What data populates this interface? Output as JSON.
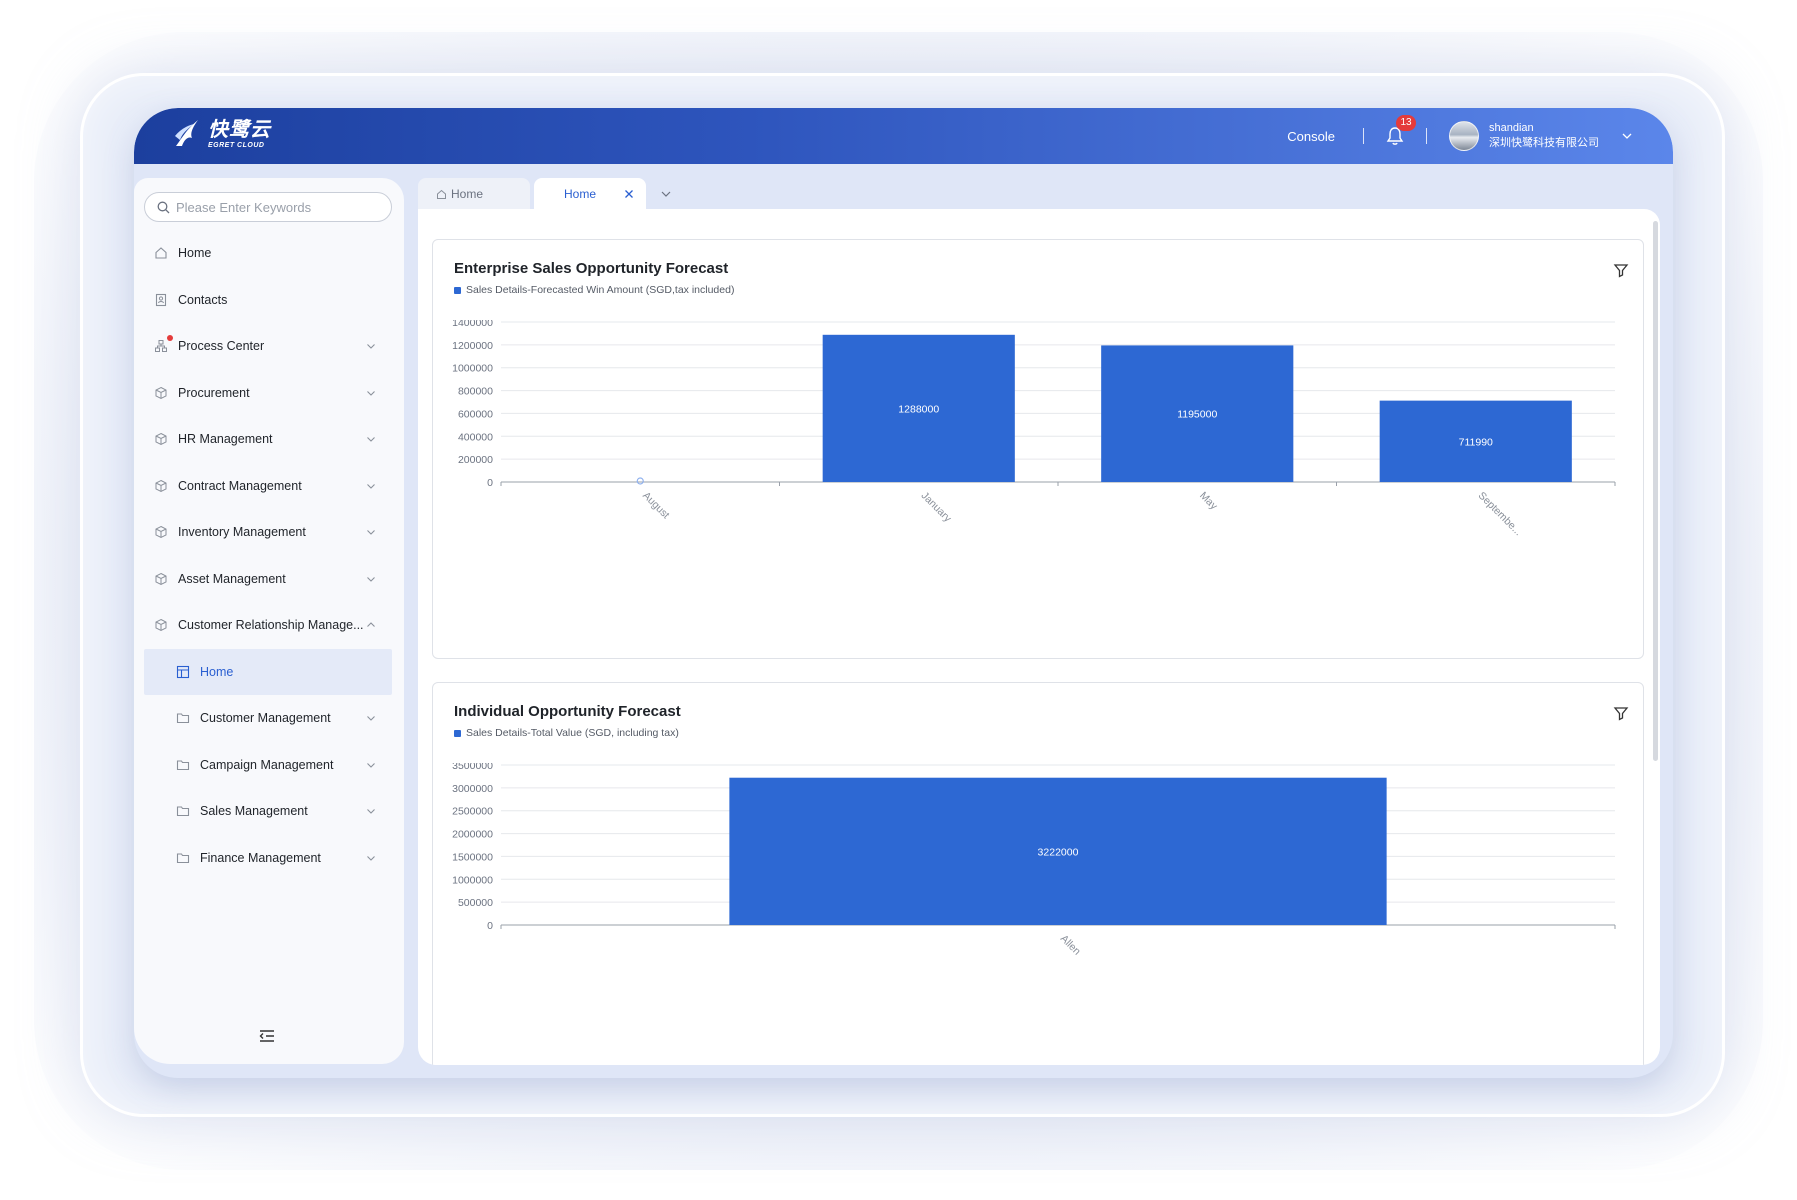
{
  "header": {
    "logo_cn": "快鹭云",
    "logo_en": "EGRET CLOUD",
    "console_label": "Console",
    "notification_count": "13",
    "user_name": "shandian",
    "user_org": "深圳快鹭科技有限公司"
  },
  "sidebar": {
    "search_placeholder": "Please Enter Keywords",
    "items": [
      {
        "label": "Home",
        "icon": "home-icon"
      },
      {
        "label": "Contacts",
        "icon": "contacts-icon"
      },
      {
        "label": "Process Center",
        "icon": "process-icon"
      },
      {
        "label": "Procurement",
        "icon": "cube-icon"
      },
      {
        "label": "HR Management",
        "icon": "cube-icon"
      },
      {
        "label": "Contract Management",
        "icon": "cube-icon"
      },
      {
        "label": "Inventory Management",
        "icon": "cube-icon"
      },
      {
        "label": "Asset Management",
        "icon": "cube-icon"
      },
      {
        "label": "Customer Relationship Manage...",
        "icon": "cube-icon"
      },
      {
        "label": "Home",
        "icon": "layout-icon"
      },
      {
        "label": "Customer Management",
        "icon": "folder-icon"
      },
      {
        "label": "Campaign Management",
        "icon": "folder-icon"
      },
      {
        "label": "Sales Management",
        "icon": "folder-icon"
      },
      {
        "label": "Finance Management",
        "icon": "folder-icon"
      }
    ]
  },
  "tabs": [
    {
      "label": "Home"
    },
    {
      "label": "Home"
    }
  ],
  "colors": {
    "accent": "#2a5fd1",
    "bar": "#2d68d3",
    "badge": "#e43b3b"
  },
  "chart_data": [
    {
      "type": "bar",
      "title": "Enterprise Sales Opportunity Forecast",
      "legend": "Sales Details-Forecasted Win Amount (SGD,tax included)",
      "categories": [
        "August",
        "January",
        "May",
        "Septembe..."
      ],
      "values": [
        0,
        1288000,
        1195000,
        711990
      ],
      "ylim": [
        0,
        1400000
      ],
      "yticks": [
        "0",
        "200000",
        "400000",
        "600000",
        "800000",
        "1000000",
        "1200000",
        "1400000"
      ],
      "grid": true
    },
    {
      "type": "bar",
      "title": "Individual Opportunity Forecast",
      "legend": "Sales Details-Total Value (SGD, including tax)",
      "categories": [
        "Allen"
      ],
      "values": [
        3222000
      ],
      "ylim": [
        0,
        3500000
      ],
      "yticks": [
        "0",
        "500000",
        "1000000",
        "1500000",
        "2000000",
        "2500000",
        "3000000",
        "3500000"
      ],
      "grid": true
    }
  ]
}
